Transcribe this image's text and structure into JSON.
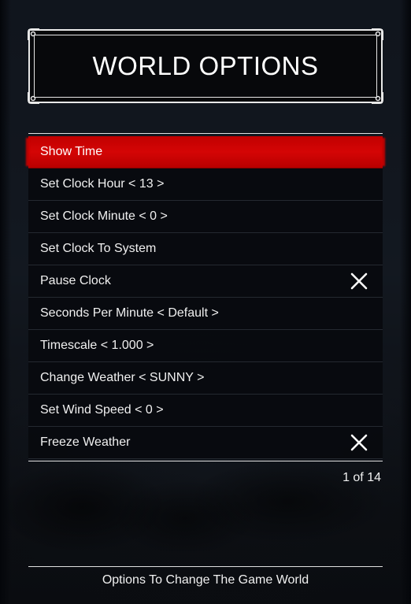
{
  "header": {
    "title": "WORLD OPTIONS"
  },
  "menu": {
    "items": [
      {
        "label": "Show Time",
        "selected": true,
        "toggle": null
      },
      {
        "label": "Set Clock Hour < 13 >",
        "selected": false,
        "toggle": null
      },
      {
        "label": "Set Clock Minute < 0 >",
        "selected": false,
        "toggle": null
      },
      {
        "label": "Set Clock To System",
        "selected": false,
        "toggle": null
      },
      {
        "label": "Pause Clock",
        "selected": false,
        "toggle": "off",
        "icon": "x-icon"
      },
      {
        "label": "Seconds Per Minute < Default >",
        "selected": false,
        "toggle": null
      },
      {
        "label": "Timescale < 1.000 >",
        "selected": false,
        "toggle": null
      },
      {
        "label": "Change Weather < SUNNY >",
        "selected": false,
        "toggle": null
      },
      {
        "label": "Set Wind Speed < 0 >",
        "selected": false,
        "toggle": null
      },
      {
        "label": "Freeze Weather",
        "selected": false,
        "toggle": "off",
        "icon": "x-icon"
      }
    ]
  },
  "pagination": {
    "text": "1 of 14"
  },
  "footer": {
    "description": "Options To Change The Game World"
  },
  "colors": {
    "highlight": "#c80000",
    "text": "#f0f0f0",
    "panel": "#07080b"
  }
}
